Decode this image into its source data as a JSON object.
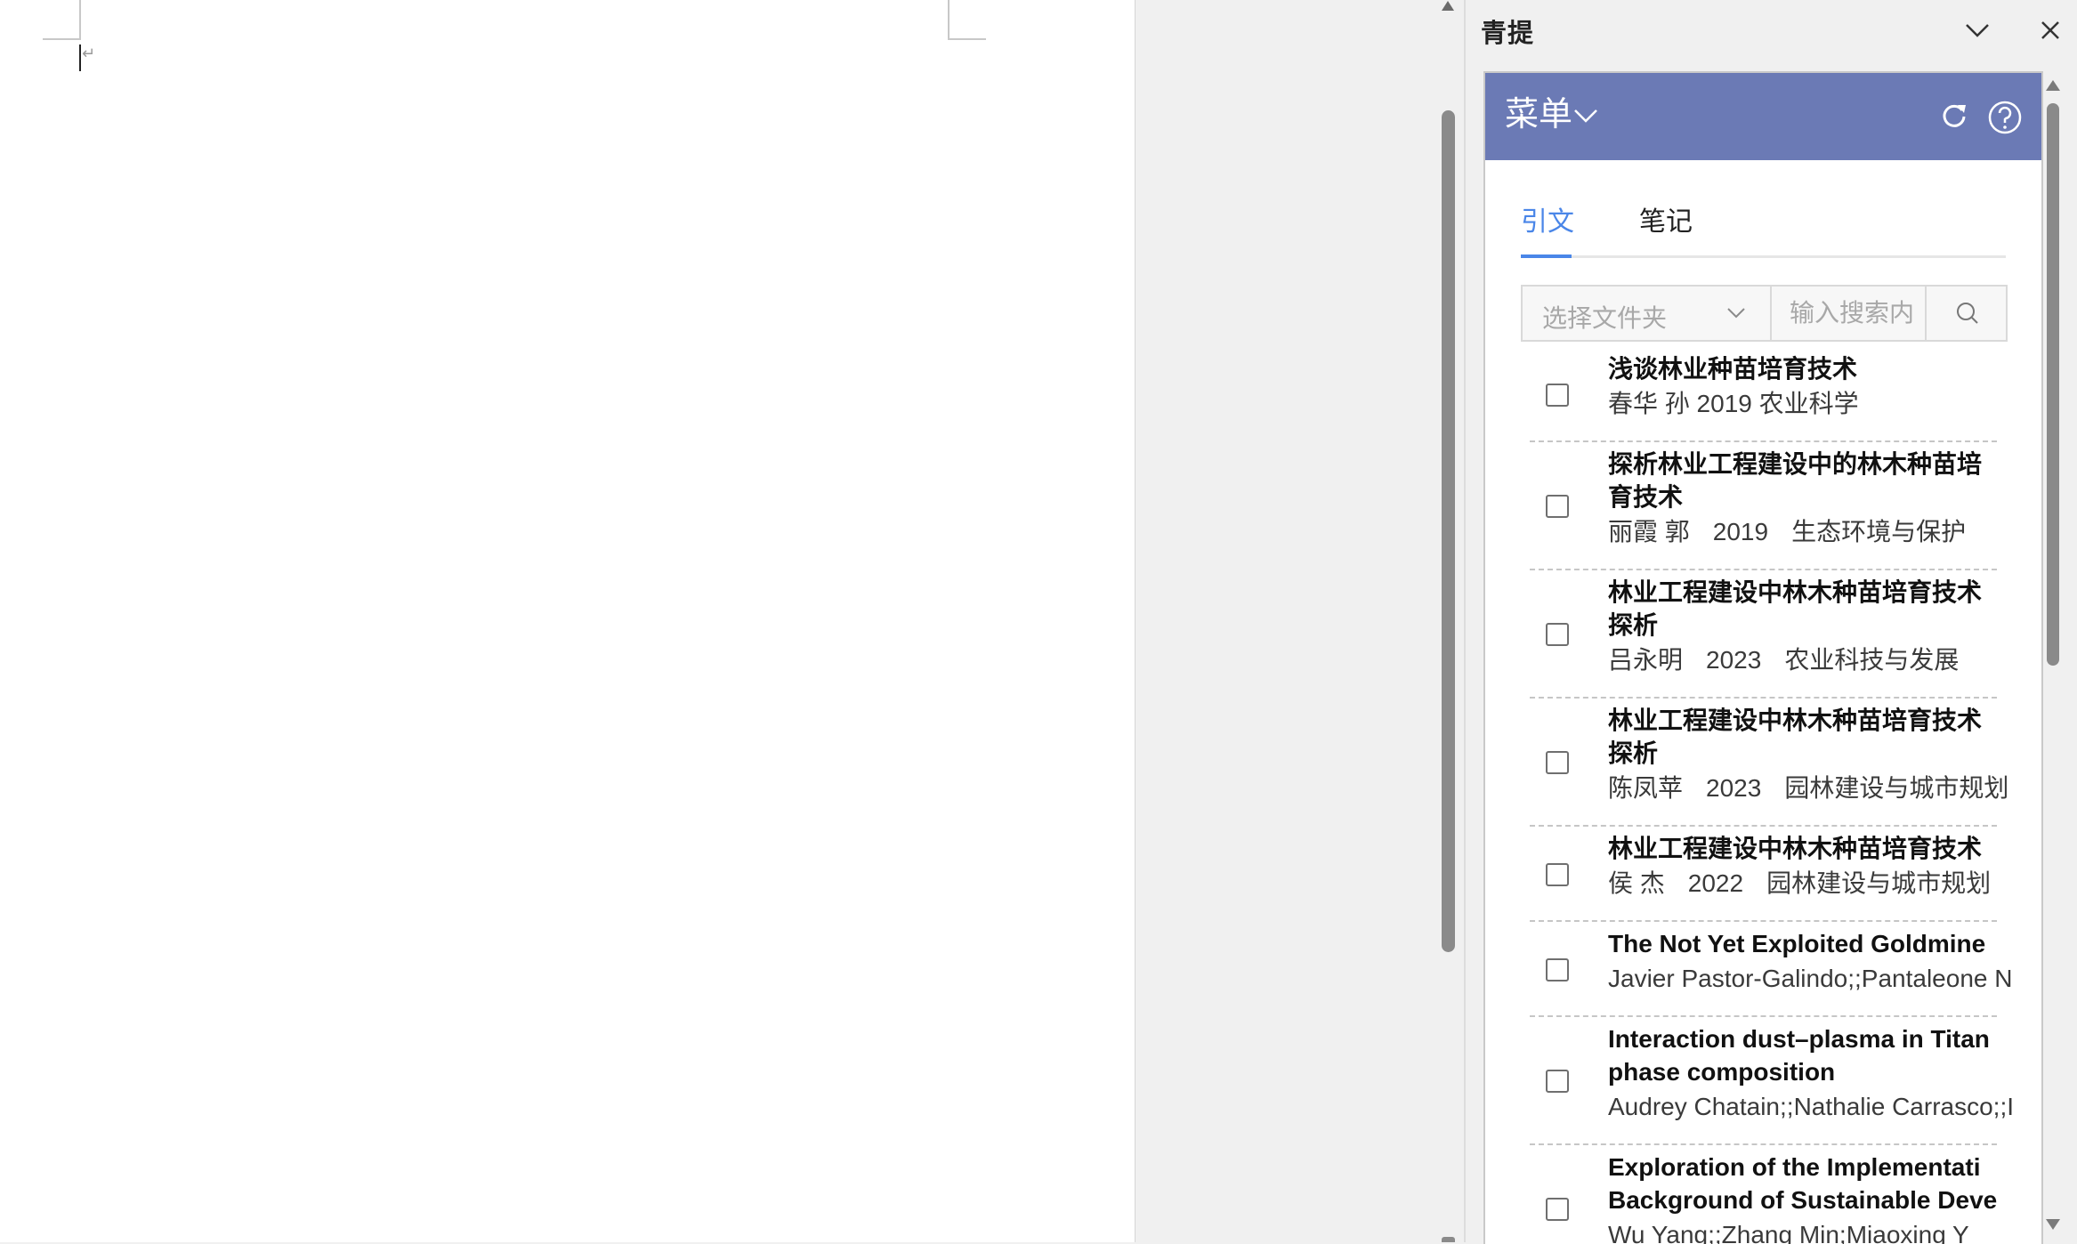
{
  "document": {
    "paragraph_mark": "↵"
  },
  "pane": {
    "title": "青提",
    "options_icon": "chevron-down-icon",
    "close_icon": "close-icon"
  },
  "addin": {
    "header_color": "#6b7ab5",
    "menu_label": "菜单",
    "refresh_icon": "refresh-icon",
    "help_icon": "help-circle-icon",
    "tabs": [
      {
        "label": "引文",
        "active": true
      },
      {
        "label": "笔记",
        "active": false
      }
    ],
    "accent_color": "#4a86e8",
    "folder_select": {
      "placeholder": "选择文件夹"
    },
    "search": {
      "placeholder": "输入搜索内"
    },
    "references": [
      {
        "title_lines": [
          "浅谈林业种苗培育技术"
        ],
        "meta": [
          "春华 孙 2019 农业科学"
        ]
      },
      {
        "title_lines": [
          "探析林业工程建设中的林木种苗培",
          "育技术"
        ],
        "meta": [
          "丽霞 郭",
          "2019",
          "生态环境与保护"
        ]
      },
      {
        "title_lines": [
          "林业工程建设中林木种苗培育技术",
          "探析"
        ],
        "meta": [
          "吕永明",
          "2023",
          "农业科技与发展"
        ]
      },
      {
        "title_lines": [
          "林业工程建设中林木种苗培育技术",
          "探析"
        ],
        "meta": [
          "陈凤苹",
          "2023",
          "园林建设与城市规划"
        ]
      },
      {
        "title_lines": [
          "林业工程建设中林木种苗培育技术"
        ],
        "meta": [
          "侯 杰",
          "2022",
          "园林建设与城市规划"
        ]
      },
      {
        "title_lines": [
          "The Not Yet Exploited Goldmine"
        ],
        "meta": [
          "Javier Pastor-Galindo;;Pantaleone Ne"
        ]
      },
      {
        "title_lines": [
          "Interaction dust–plasma in Titan",
          "phase composition"
        ],
        "meta": [
          "Audrey Chatain;;Nathalie Carrasco;;I"
        ]
      },
      {
        "title_lines": [
          "Exploration of the Implementati",
          "Background of Sustainable Deve"
        ],
        "meta": [
          "Wu Yang;;Zhang Min;Miaoxing Y"
        ]
      }
    ]
  }
}
